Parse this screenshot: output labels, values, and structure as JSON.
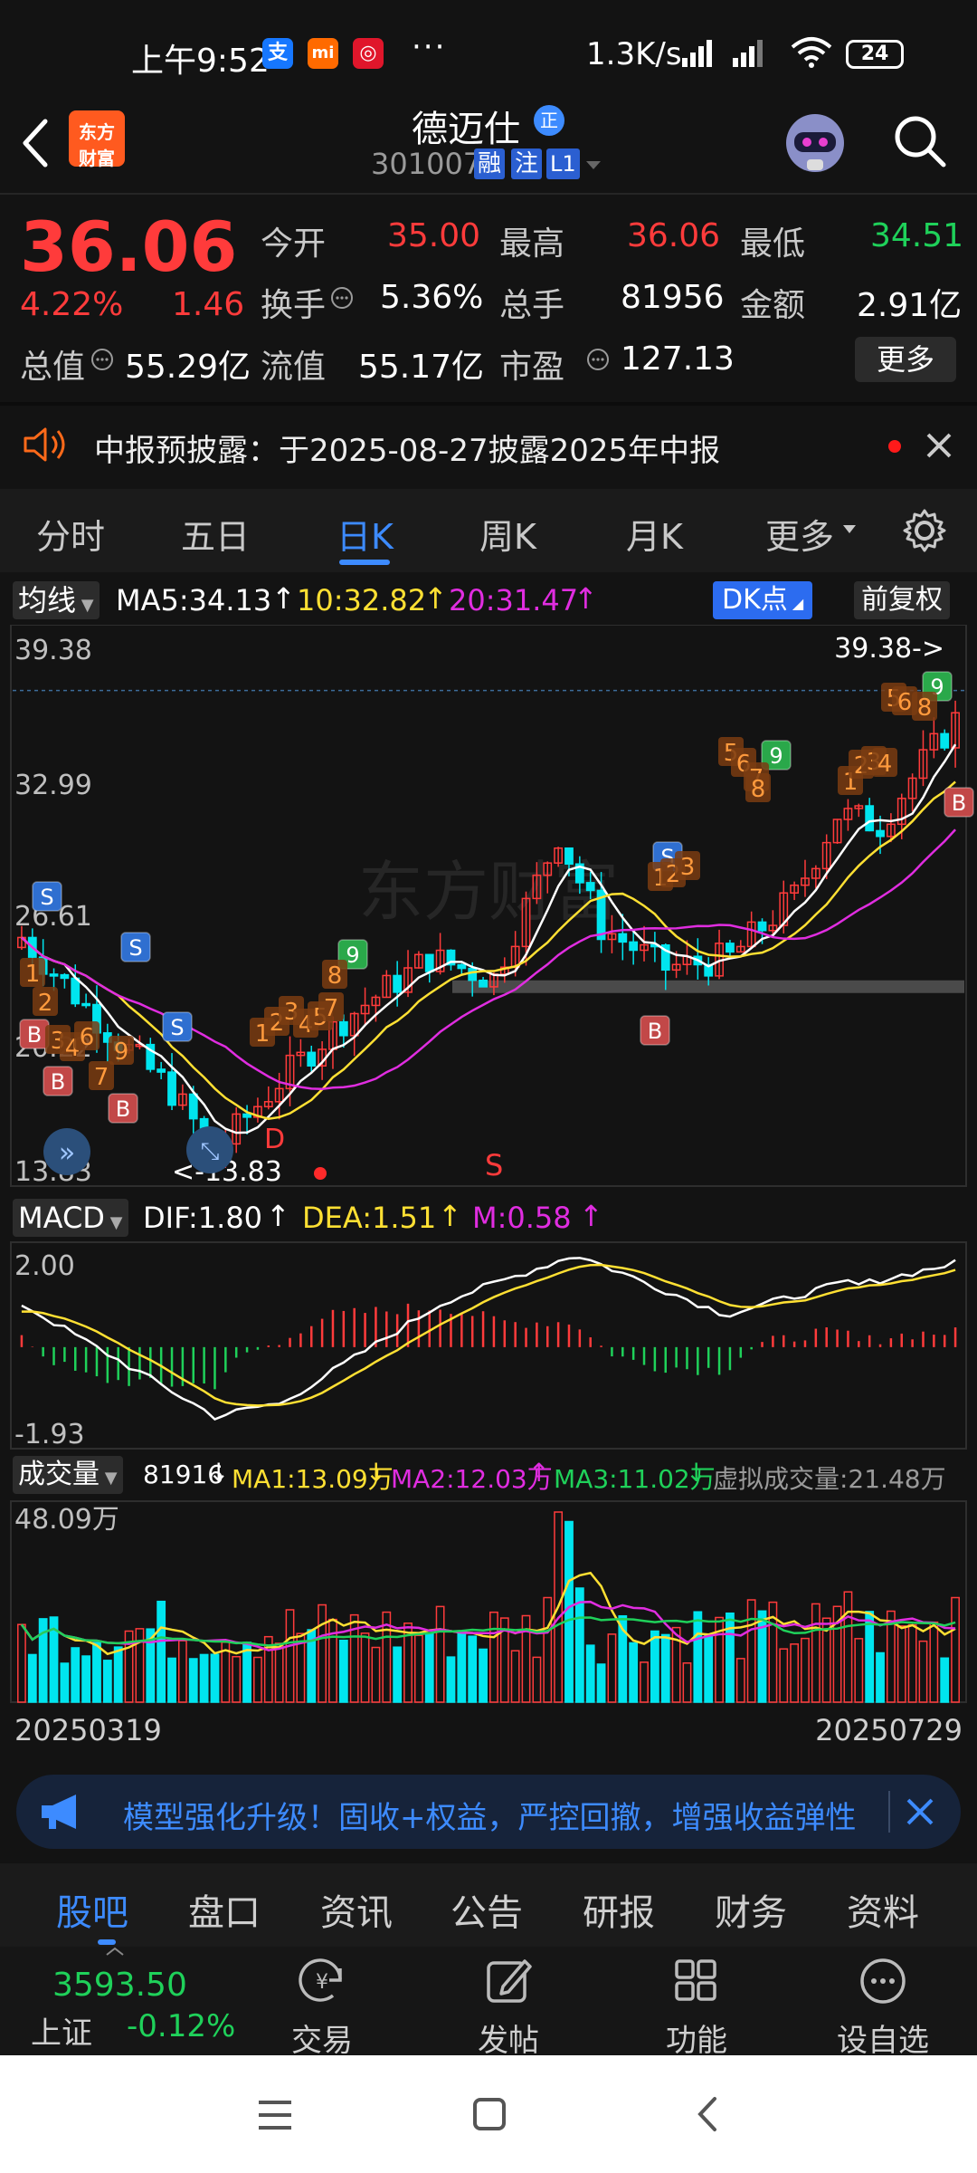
{
  "status_bar": {
    "time": "上午9:52",
    "app_icons": [
      "支",
      "mi",
      "◎"
    ],
    "more": "···",
    "net_speed": "1.3K/s",
    "battery": "24"
  },
  "header": {
    "logo_line1": "东方",
    "logo_line2": "财富",
    "stock_name": "德迈仕",
    "badge": "正",
    "code": "301007",
    "tags": [
      "融",
      "注",
      "L1"
    ]
  },
  "quote": {
    "price": "36.06",
    "change_pct": "4.22%",
    "change_abs": "1.46",
    "rows": [
      [
        {
          "label": "今开",
          "value": "35.00",
          "color": "red"
        },
        {
          "label": "最高",
          "value": "36.06",
          "color": "red"
        },
        {
          "label": "最低",
          "value": "34.51",
          "color": "green"
        }
      ],
      [
        {
          "label": "换手",
          "value": "5.36%",
          "color": "white"
        },
        {
          "label": "总手",
          "value": "81956",
          "color": "white"
        },
        {
          "label": "金额",
          "value": "2.91亿",
          "color": "white"
        }
      ],
      [
        {
          "label": "总值",
          "value": "55.29亿",
          "color": "white"
        },
        {
          "label": "流值",
          "value": "55.17亿",
          "color": "white"
        },
        {
          "label": "市盈",
          "value": "127.13",
          "color": "white"
        }
      ]
    ],
    "more_button": "更多"
  },
  "notice": {
    "text": "中报预披露：于2025-08-27披露2025年中报"
  },
  "period_tabs": [
    "分时",
    "五日",
    "日K",
    "周K",
    "月K",
    "更多"
  ],
  "active_period": "日K",
  "ma_row": {
    "selector": "均线",
    "ma5": "MA5:34.13",
    "ma10": "10:32.82",
    "ma20": "20:31.47",
    "dk_button": "DK点",
    "fq_button": "前复权"
  },
  "kline": {
    "y_top": "39.38",
    "y_mid": "32.99",
    "y_third": "26.61",
    "y_fourth": "20.22",
    "y_bottom": "13.83",
    "high_annotation": "39.38->",
    "low_annotation": "<-13.83",
    "watermark": "东方财富",
    "marker_d": "D",
    "marker_s": "S"
  },
  "macd_row": {
    "selector": "MACD",
    "dif": "DIF:1.80",
    "dea": "DEA:1.51",
    "m": "M:0.58",
    "y_top": "2.00",
    "y_bottom": "-1.93"
  },
  "volume_row": {
    "selector": "成交量",
    "vol": "81916",
    "ma1": "MA1:13.09万",
    "ma2": "MA2:12.03万",
    "ma3": "MA3:11.02万",
    "virtual": "虚拟成交量:21.48万",
    "y_top": "48.09万",
    "date_start": "20250319",
    "date_end": "20250729"
  },
  "promo": {
    "text": "模型强化升级！固收+权益，严控回撤，增强收益弹性"
  },
  "bottom_tabs": [
    "股吧",
    "盘口",
    "资讯",
    "公告",
    "研报",
    "财务",
    "资料"
  ],
  "active_bottom_tab": "股吧",
  "index_ticker": {
    "value": "3593.50",
    "name": "上证",
    "change": "-0.12%"
  },
  "actions": [
    "交易",
    "发帖",
    "功能",
    "设自选"
  ],
  "colors": {
    "up": "#ff3b3b",
    "down": "#1fd15a",
    "accent": "#3d8bff",
    "ma5": "#ffffff",
    "ma10": "#ffe033",
    "ma20": "#e02de0",
    "volume_down": "#00e5ef"
  }
}
